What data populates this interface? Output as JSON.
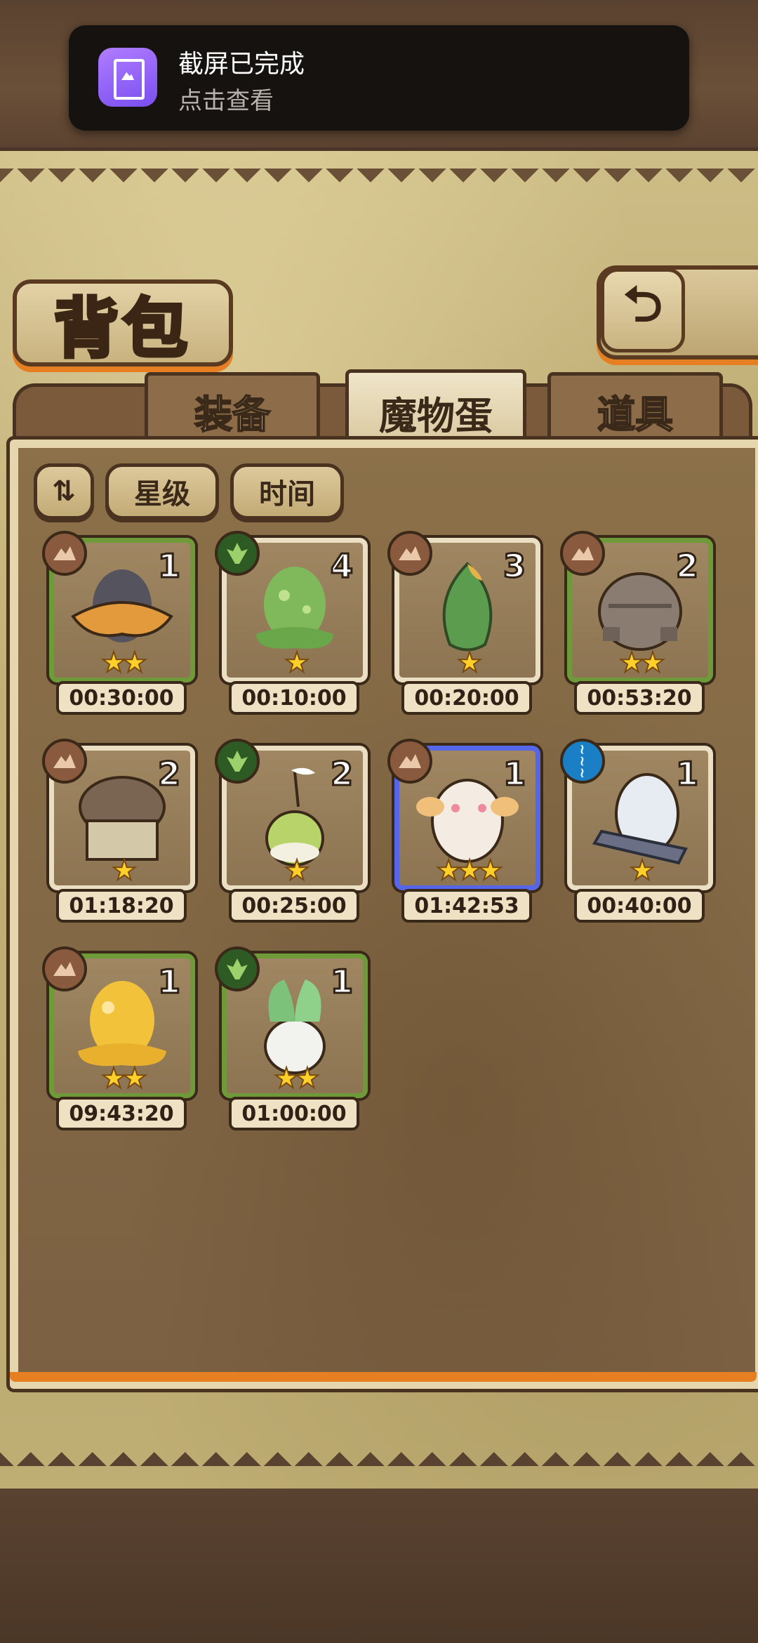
{
  "notification": {
    "title": "截屏已完成",
    "subtitle": "点击查看"
  },
  "header": {
    "title": "背包",
    "back_icon": "back-arrow-icon"
  },
  "tabs": [
    {
      "label": "装备",
      "active": false
    },
    {
      "label": "魔物蛋",
      "active": true
    },
    {
      "label": "道具",
      "active": false
    }
  ],
  "sort": {
    "toggle_icon": "sort-toggle-icon",
    "star_label": "星级",
    "time_label": "时间"
  },
  "items": [
    {
      "count": "1",
      "timer": "00:30:00",
      "element": "earth",
      "stars": 2,
      "border": "green",
      "art": "dark-hat-egg"
    },
    {
      "count": "4",
      "timer": "00:10:00",
      "element": "grass",
      "stars": 1,
      "border": "cream",
      "art": "green-slime-egg"
    },
    {
      "count": "3",
      "timer": "00:20:00",
      "element": "earth",
      "stars": 1,
      "border": "cream",
      "art": "leaf-bud-egg"
    },
    {
      "count": "2",
      "timer": "00:53:20",
      "element": "earth",
      "stars": 2,
      "border": "green",
      "art": "stone-golem-egg"
    },
    {
      "count": "2",
      "timer": "01:18:20",
      "element": "earth",
      "stars": 1,
      "border": "cream",
      "art": "mushroom-egg"
    },
    {
      "count": "2",
      "timer": "00:25:00",
      "element": "grass",
      "stars": 1,
      "border": "cream",
      "art": "sprout-bulb-egg"
    },
    {
      "count": "1",
      "timer": "01:42:53",
      "element": "earth",
      "stars": 3,
      "border": "blue",
      "art": "fluffy-moth-egg"
    },
    {
      "count": "1",
      "timer": "00:40:00",
      "element": "water",
      "stars": 1,
      "border": "cream",
      "art": "white-striped-egg"
    },
    {
      "count": "1",
      "timer": "09:43:20",
      "element": "earth",
      "stars": 2,
      "border": "green",
      "art": "golden-slime-egg"
    },
    {
      "count": "1",
      "timer": "01:00:00",
      "element": "grass",
      "stars": 2,
      "border": "green",
      "art": "turnip-egg"
    }
  ]
}
